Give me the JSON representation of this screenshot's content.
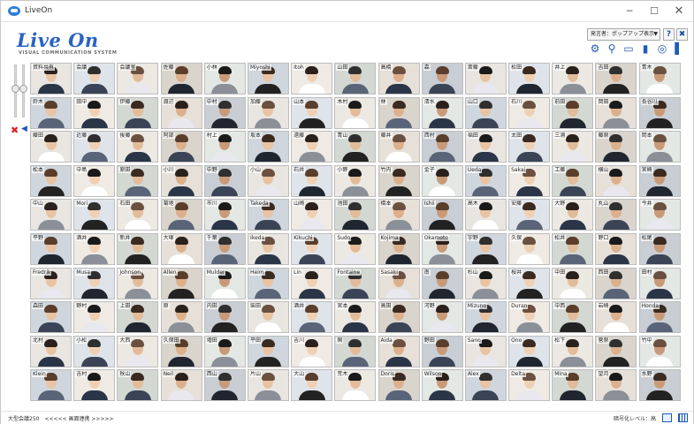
{
  "window": {
    "title": "LiveOn"
  },
  "header": {
    "logo_text": "Live On",
    "logo_subtitle": "VISUAL COMMUNICATION SYSTEM",
    "speaker_select_value": "発言者：ポップアップ表示",
    "help_label": "?",
    "close_label": "✖"
  },
  "toolbar": {
    "icons": [
      "gear-icon",
      "search-icon",
      "bookmark-icon",
      "bar-chart-icon",
      "zoom-user-icon",
      "signal-icon"
    ]
  },
  "status": {
    "left": "大型会議250　<<<<< 画面連携 >>>>>",
    "right": "暗号化レベル：高"
  },
  "colors": {
    "accent": "#2a62c4",
    "mute": "#d62828"
  },
  "participants": [
    {
      "name": "資料共有"
    },
    {
      "name": "会議"
    },
    {
      "name": "会議室"
    },
    {
      "name": "佐藤"
    },
    {
      "name": "小林"
    },
    {
      "name": "Miyoshi"
    },
    {
      "name": "Itoh"
    },
    {
      "name": "山田"
    },
    {
      "name": "高橋"
    },
    {
      "name": "森"
    },
    {
      "name": "斎藤"
    },
    {
      "name": "松田"
    },
    {
      "name": "井上"
    },
    {
      "name": "吉田"
    },
    {
      "name": "青木"
    },
    {
      "name": "鈴木"
    },
    {
      "name": "田中"
    },
    {
      "name": "伊藤"
    },
    {
      "name": "渡辺"
    },
    {
      "name": "中村"
    },
    {
      "name": "加藤"
    },
    {
      "name": "山本"
    },
    {
      "name": "木村"
    },
    {
      "name": "林"
    },
    {
      "name": "清水"
    },
    {
      "name": "山口"
    },
    {
      "name": "石川"
    },
    {
      "name": "前田"
    },
    {
      "name": "岡田"
    },
    {
      "name": "長谷川"
    },
    {
      "name": "藤田"
    },
    {
      "name": "近藤"
    },
    {
      "name": "後藤"
    },
    {
      "name": "阿部"
    },
    {
      "name": "村上"
    },
    {
      "name": "坂本"
    },
    {
      "name": "遠藤"
    },
    {
      "name": "青山"
    },
    {
      "name": "藤井"
    },
    {
      "name": "西村"
    },
    {
      "name": "福田"
    },
    {
      "name": "太田"
    },
    {
      "name": "三浦"
    },
    {
      "name": "藤原"
    },
    {
      "name": "岡本"
    },
    {
      "name": "松本"
    },
    {
      "name": "中島"
    },
    {
      "name": "原田"
    },
    {
      "name": "小川"
    },
    {
      "name": "中野"
    },
    {
      "name": "小山"
    },
    {
      "name": "石井"
    },
    {
      "name": "小野"
    },
    {
      "name": "竹内"
    },
    {
      "name": "金子"
    },
    {
      "name": "Ueda"
    },
    {
      "name": "Sakai"
    },
    {
      "name": "工藤"
    },
    {
      "name": "横山"
    },
    {
      "name": "宮崎"
    },
    {
      "name": "中山"
    },
    {
      "name": "Mori"
    },
    {
      "name": "石田"
    },
    {
      "name": "菊地"
    },
    {
      "name": "市川"
    },
    {
      "name": "Takeda"
    },
    {
      "name": "山崎"
    },
    {
      "name": "池田"
    },
    {
      "name": "橋本"
    },
    {
      "name": "Ishii"
    },
    {
      "name": "高木"
    },
    {
      "name": "安藤"
    },
    {
      "name": "大野"
    },
    {
      "name": "丸山"
    },
    {
      "name": "今井"
    },
    {
      "name": "平野"
    },
    {
      "name": "酒井"
    },
    {
      "name": "新井"
    },
    {
      "name": "大塚"
    },
    {
      "name": "千葉"
    },
    {
      "name": "Ikeda"
    },
    {
      "name": "Kikuchi"
    },
    {
      "name": "Sudo"
    },
    {
      "name": "Kojima"
    },
    {
      "name": "Okamoto"
    },
    {
      "name": "宇野"
    },
    {
      "name": "久保"
    },
    {
      "name": "松井"
    },
    {
      "name": "野口"
    },
    {
      "name": "松尾"
    },
    {
      "name": "Fredrik"
    },
    {
      "name": "Musa"
    },
    {
      "name": "Johnson"
    },
    {
      "name": "Allen"
    },
    {
      "name": "Mulder"
    },
    {
      "name": "Heim"
    },
    {
      "name": "Lin"
    },
    {
      "name": "Fontaine"
    },
    {
      "name": "Sasaki"
    },
    {
      "name": "南"
    },
    {
      "name": "杉山"
    },
    {
      "name": "桜井"
    },
    {
      "name": "中田"
    },
    {
      "name": "西田"
    },
    {
      "name": "田村"
    },
    {
      "name": "森田"
    },
    {
      "name": "野村"
    },
    {
      "name": "上田"
    },
    {
      "name": "原"
    },
    {
      "name": "内田"
    },
    {
      "name": "柴田"
    },
    {
      "name": "酒井"
    },
    {
      "name": "宮本"
    },
    {
      "name": "高田"
    },
    {
      "name": "河野"
    },
    {
      "name": "Mizuno"
    },
    {
      "name": "Duran"
    },
    {
      "name": "中西"
    },
    {
      "name": "岩崎"
    },
    {
      "name": "Honda"
    },
    {
      "name": "北村"
    },
    {
      "name": "小松"
    },
    {
      "name": "大西"
    },
    {
      "name": "久保田"
    },
    {
      "name": "増田"
    },
    {
      "name": "平田"
    },
    {
      "name": "吉川"
    },
    {
      "name": "関"
    },
    {
      "name": "Aida"
    },
    {
      "name": "野田"
    },
    {
      "name": "Sano"
    },
    {
      "name": "Ono"
    },
    {
      "name": "松下"
    },
    {
      "name": "菅原"
    },
    {
      "name": "竹中"
    },
    {
      "name": "Klein"
    },
    {
      "name": "吉村"
    },
    {
      "name": "秋山"
    },
    {
      "name": "Neil"
    },
    {
      "name": "西山"
    },
    {
      "name": "片山"
    },
    {
      "name": "大山"
    },
    {
      "name": "荒木"
    },
    {
      "name": "Doris"
    },
    {
      "name": "Wilson"
    },
    {
      "name": "Alex"
    },
    {
      "name": "Delta"
    },
    {
      "name": "Mina"
    },
    {
      "name": "望月"
    },
    {
      "name": "水野"
    }
  ]
}
